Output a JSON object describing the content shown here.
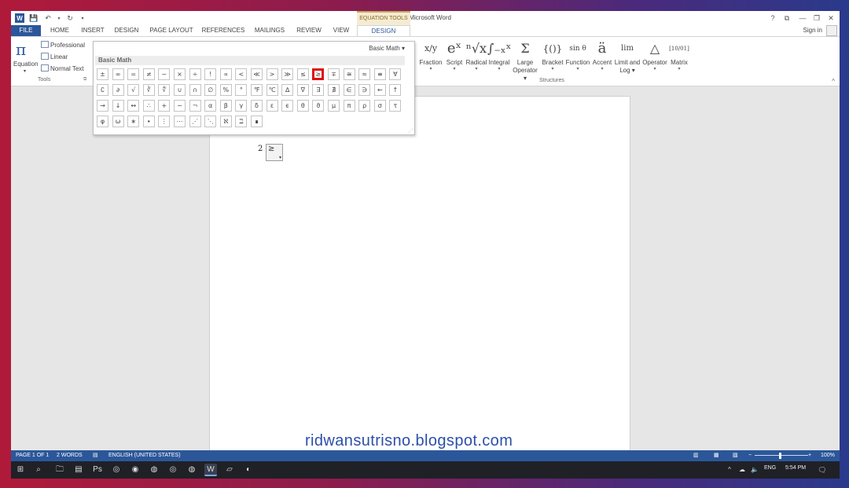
{
  "window": {
    "title": "Document1 - Microsoft Word",
    "contextual_tab_group": "EQUATION TOOLS",
    "help": "?",
    "ribbon_display": "⧉",
    "minimize": "—",
    "restore": "❐",
    "close": "✕",
    "sign_in": "Sign in"
  },
  "qat": {
    "word_logo": "W",
    "save_icon": "💾",
    "undo_icon": "↶",
    "redo_icon": "↻",
    "customize_icon": "▾"
  },
  "tabs": [
    "FILE",
    "HOME",
    "INSERT",
    "DESIGN",
    "PAGE LAYOUT",
    "REFERENCES",
    "MAILINGS",
    "REVIEW",
    "VIEW",
    "DESIGN"
  ],
  "ribbon": {
    "equation": {
      "glyph": "π",
      "label": "Equation",
      "dropdown": "▾"
    },
    "tools": {
      "professional": "Professional",
      "linear": "Linear",
      "normal_text": "Normal Text",
      "group_label": "Tools",
      "launcher": "⧉"
    },
    "structures": [
      {
        "glyph": "x/y",
        "label": "Fraction",
        "dropdown": "▾"
      },
      {
        "glyph": "eˣ",
        "label": "Script",
        "dropdown": "▾"
      },
      {
        "glyph": "ⁿ√x",
        "label": "Radical",
        "dropdown": "▾"
      },
      {
        "glyph": "∫₋ₓˣ",
        "label": "Integral",
        "dropdown": "▾"
      },
      {
        "glyph": "Σ",
        "label": "Large",
        "label2": "Operator ▾"
      },
      {
        "glyph": "{()}",
        "label": "Bracket",
        "dropdown": "▾"
      },
      {
        "glyph": "sin θ",
        "label": "Function",
        "dropdown": "▾"
      },
      {
        "glyph": "ä",
        "label": "Accent",
        "dropdown": "▾"
      },
      {
        "glyph": "lim",
        "label": "Limit and",
        "label2": "Log ▾"
      },
      {
        "glyph": "△",
        "label": "Operator",
        "dropdown": "▾"
      },
      {
        "glyph": "[10/01]",
        "label": "Matrix",
        "dropdown": "▾"
      }
    ],
    "structures_label": "Structures",
    "collapse": "^"
  },
  "gallery": {
    "header": "Basic Math ▾",
    "section": "Basic Math",
    "selected_index": 14,
    "symbols": [
      "±",
      "∞",
      "=",
      "≠",
      "~",
      "×",
      "÷",
      "!",
      "∝",
      "<",
      "≪",
      ">",
      "≫",
      "≤",
      "≥",
      "∓",
      "≅",
      "≈",
      "≡",
      "∀",
      "∁",
      "∂",
      "√",
      "∛",
      "∜",
      "∪",
      "∩",
      "∅",
      "%",
      "°",
      "℉",
      "℃",
      "∆",
      "∇",
      "∃",
      "∄",
      "∈",
      "∋",
      "←",
      "↑",
      "→",
      "↓",
      "↔",
      "∴",
      "+",
      "−",
      "¬",
      "α",
      "β",
      "γ",
      "δ",
      "ε",
      "ϵ",
      "θ",
      "ϑ",
      "μ",
      "π",
      "ρ",
      "σ",
      "τ",
      "φ",
      "ω",
      "∗",
      "∙",
      "⋮",
      "⋯",
      "⋰",
      "⋱",
      "ℵ",
      "ℶ",
      "∎"
    ],
    "grip": "⋰"
  },
  "document": {
    "equation_prefix": "2",
    "equation_symbol": "≥",
    "equation_handle": "▾",
    "watermark": "ridwansutrisno.blogspot.com"
  },
  "statusbar": {
    "page": "PAGE 1 OF 1",
    "words": "2 WORDS",
    "proofing_icon": "▤",
    "language": "ENGLISH (UNITED STATES)",
    "read_mode_icon": "▥",
    "print_layout_icon": "▦",
    "web_layout_icon": "▧",
    "zoom_out": "−",
    "zoom_in": "+",
    "zoom": "100%"
  },
  "taskbar": {
    "start_icon": "⊞",
    "search_icon": "⌕",
    "apps": [
      "🗀",
      "▤",
      "Ps",
      "◎",
      "◉",
      "◍",
      "◎",
      "◍",
      "W",
      "▱",
      "◐"
    ],
    "tray_up": "^",
    "network": "☁",
    "volume": "🔈",
    "lang": "ENG",
    "time": "5:54 PM",
    "notifications": "🗨"
  },
  "colors": {
    "word_blue": "#2b579a",
    "selection_red": "#dd1111",
    "contextual_gold": "#c9a856",
    "watermark_blue": "#2b4fa8"
  }
}
